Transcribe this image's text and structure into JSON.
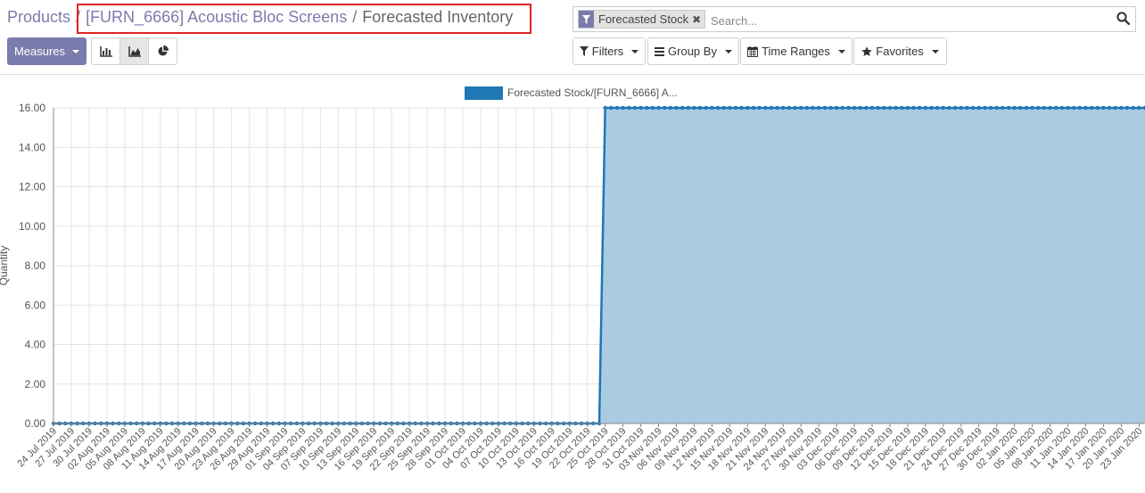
{
  "breadcrumb": {
    "root": "Products",
    "product": "[FURN_6666] Acoustic Bloc Screens",
    "current": "Forecasted Inventory",
    "separator": "/"
  },
  "search": {
    "facet_label": "Forecasted Stock",
    "placeholder": "Search..."
  },
  "toolbar": {
    "measures_label": "Measures",
    "views": [
      "bar-chart",
      "line-chart",
      "pie-chart"
    ],
    "active_view": "line-chart",
    "filters_label": "Filters",
    "group_by_label": "Group By",
    "time_ranges_label": "Time Ranges",
    "favorites_label": "Favorites"
  },
  "colors": {
    "brand": "#7c7bad",
    "series_line": "#1f77b4",
    "series_fill": "#a6c8e2",
    "annotation_box": "#e02424"
  },
  "chart_data": {
    "type": "area",
    "ylabel": "Quantity",
    "ylim": [
      0,
      16
    ],
    "yticks": [
      "0.00",
      "2.00",
      "4.00",
      "6.00",
      "8.00",
      "10.00",
      "12.00",
      "14.00",
      "16.00"
    ],
    "x_start": "24 Jul 2019",
    "x_end": "24 Jan 2020",
    "x_step_days": 1,
    "tick_step_days": 3,
    "grid": true,
    "legend_position": "top-center",
    "series": [
      {
        "name": "Forecasted Stock/[FURN_6666] A...",
        "segments": [
          {
            "from": "24 Jul 2019",
            "to": "24 Oct 2019",
            "value": 0
          },
          {
            "from": "25 Oct 2019",
            "to": "24 Jan 2020",
            "value": 16
          }
        ]
      }
    ]
  }
}
